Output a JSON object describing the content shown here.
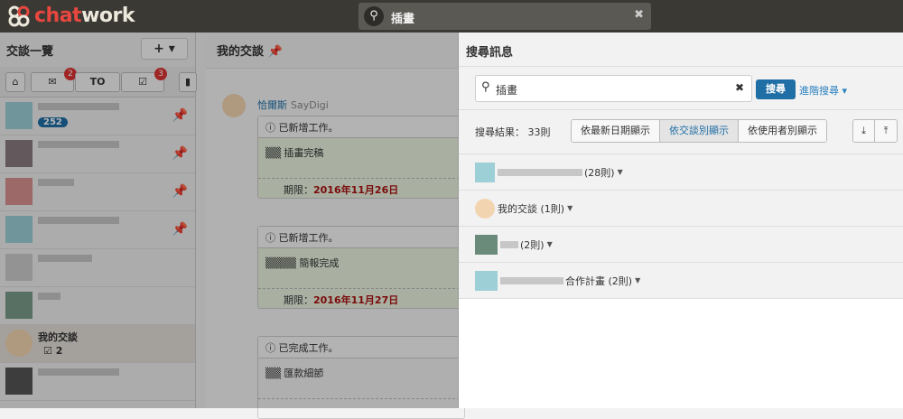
{
  "header": {
    "brand": "chat",
    "brand2": "work",
    "search_value": "插畫"
  },
  "sidebar": {
    "title": "交談一覽",
    "add": "+ ▾",
    "badges": {
      "mentions": "2",
      "tasks": "3"
    },
    "to_label": "TO",
    "room_unread": "252",
    "my_chat": "我的交談",
    "my_chat_tasks": "2"
  },
  "chat": {
    "title": "我的交談",
    "sender": "恰爾斯",
    "org": "SayDigi",
    "tasks": [
      {
        "head": "已新增工作。",
        "body": "插畫完稿",
        "due_label": "期限：",
        "due": "2016年11月26日"
      },
      {
        "head": "已新增工作。",
        "body": "簡報完成",
        "due_label": "期限：",
        "due": "2016年11月27日"
      },
      {
        "head": "已完成工作。",
        "body": "匯款細節",
        "due_label": "",
        "due": ""
      }
    ]
  },
  "search_panel": {
    "title": "搜尋訊息",
    "query": "插畫",
    "search_button": "搜尋",
    "advanced": "進階搜尋 ▾",
    "result_count": "搜尋結果： 33則",
    "views": [
      "依最新日期顯示",
      "依交談別顯示",
      "依使用者別顯示"
    ],
    "results": [
      {
        "label": "(28則)"
      },
      {
        "label": "我的交談 (1則)"
      },
      {
        "label": "(2則)"
      },
      {
        "label": "合作計畫 (2則)"
      }
    ]
  }
}
